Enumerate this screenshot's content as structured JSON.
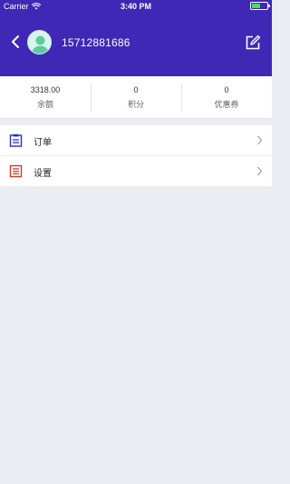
{
  "status_bar": {
    "carrier": "Carrier",
    "time": "3:40 PM",
    "battery_level": 0.55
  },
  "header": {
    "background_color": "#3f28b5",
    "username": "15712881686"
  },
  "stats": [
    {
      "value": "3318.00",
      "label": "余额"
    },
    {
      "value": "0",
      "label": "积分"
    },
    {
      "value": "0",
      "label": "优惠券"
    }
  ],
  "menu": [
    {
      "label": "订单",
      "icon": "clipboard-icon",
      "icon_color": "#2a2ec9"
    },
    {
      "label": "设置",
      "icon": "settings-list-icon",
      "icon_color": "#c8402a"
    }
  ]
}
